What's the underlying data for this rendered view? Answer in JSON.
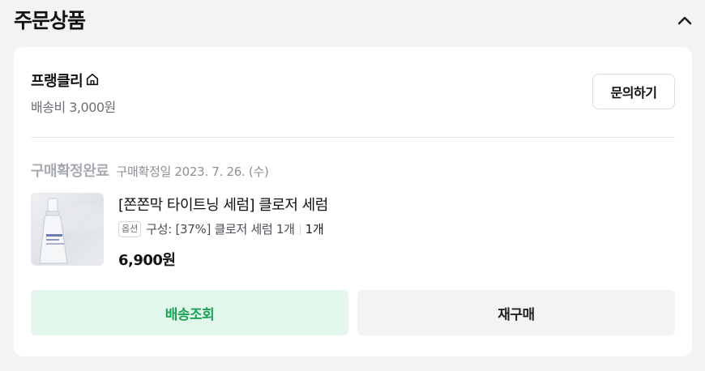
{
  "section": {
    "title": "주문상품",
    "toggle_icon": "chevron-up-icon"
  },
  "seller": {
    "name": "프랭클리",
    "store_icon": "home-icon",
    "shipping_fee": "배송비 3,000원",
    "inquiry_label": "문의하기"
  },
  "order": {
    "status": "구매확정완료",
    "status_date": "구매확정일 2023. 7. 26. (수)"
  },
  "product": {
    "name": "[쫀쫀막 타이트닝 세럼] 클로저 세럼",
    "option_badge": "옵션",
    "option_text": "구성: [37%] 클로저 세럼 1개",
    "quantity": "1개",
    "price": "6,900원"
  },
  "actions": {
    "track_label": "배송조회",
    "reorder_label": "재구매"
  },
  "colors": {
    "track_bg": "#e3f6ec",
    "track_text": "#1aa457",
    "status_muted": "#a7abb1",
    "page_bg": "#f2f3f5"
  }
}
